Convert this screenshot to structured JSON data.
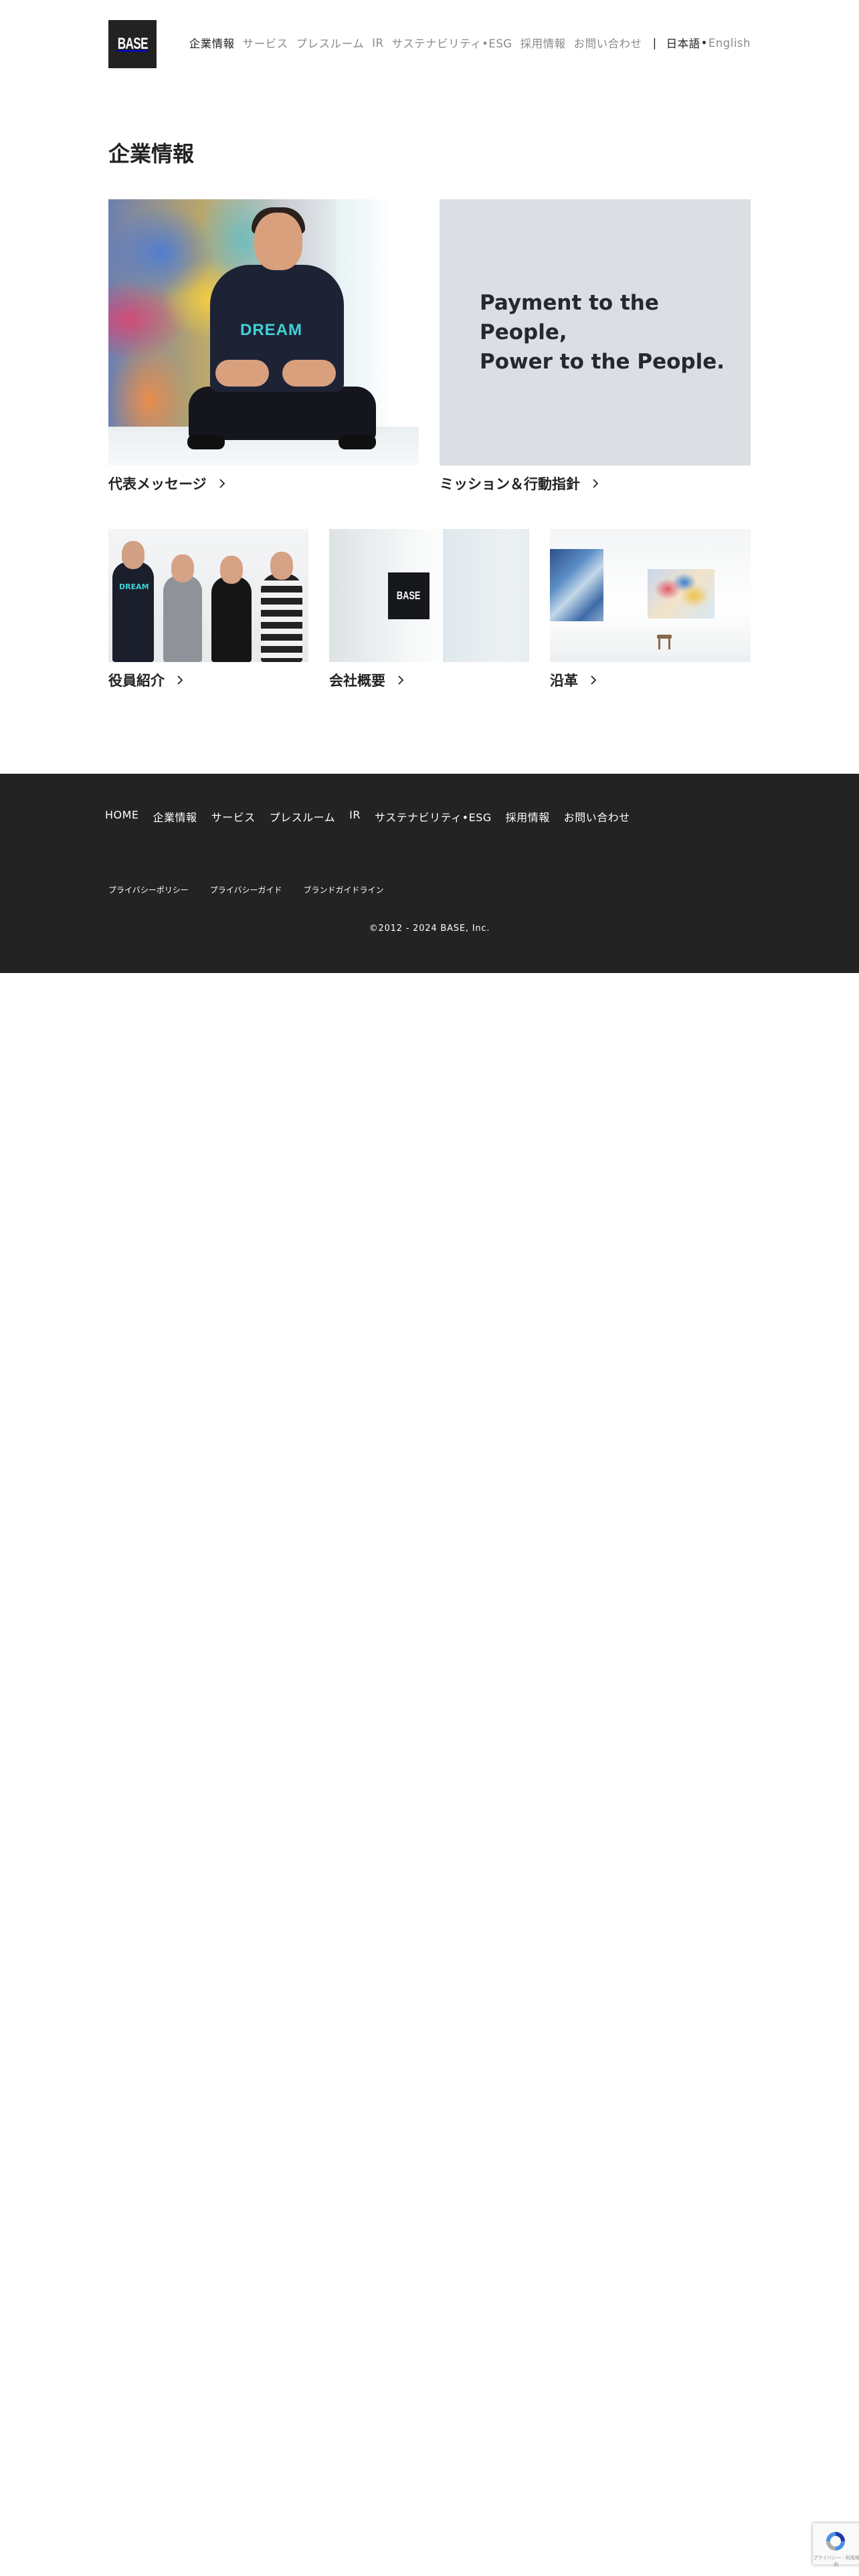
{
  "header": {
    "logo_text": "BASE",
    "nav": [
      {
        "label": "企業情報",
        "active": true
      },
      {
        "label": "サービス"
      },
      {
        "label": "プレスルーム"
      },
      {
        "label": "IR"
      },
      {
        "label": "サステナビリティ•ESG"
      },
      {
        "label": "採用情報"
      },
      {
        "label": "お問い合わせ"
      }
    ],
    "separator": "|",
    "lang_ja": "日本語",
    "lang_dot": "•",
    "lang_en": "English"
  },
  "main": {
    "title": "企業情報",
    "cards": [
      {
        "label": "代表メッセージ",
        "image": "representative-photo"
      },
      {
        "label": "ミッション＆行動指針",
        "image": "mission-graphic",
        "image_text_line1": "Payment to the People,",
        "image_text_line2": "Power to the People."
      },
      {
        "label": "役員紹介",
        "image": "officers-photo"
      },
      {
        "label": "会社概要",
        "image": "office-photo",
        "sign_text": "BASE"
      },
      {
        "label": "沿革",
        "image": "gallery-photo"
      }
    ]
  },
  "footer": {
    "nav": [
      "HOME",
      "企業情報",
      "サービス",
      "プレスルーム",
      "IR",
      "サステナビリティ•ESG",
      "採用情報",
      "お問い合わせ"
    ],
    "links": [
      "プライバシーポリシー",
      "プライバシーガイド",
      "ブランドガイドライン"
    ],
    "copyright": "©2012 - 2024 BASE, Inc."
  },
  "recaptcha": {
    "text": "プライバシー - 利用規約"
  },
  "colors": {
    "footer_bg": "#232323",
    "nav_inactive": "#8a8a8a",
    "text": "#222222",
    "mission_bg": "#dbdee3"
  }
}
